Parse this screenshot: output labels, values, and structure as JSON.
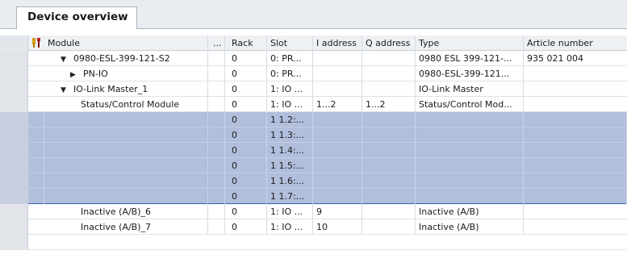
{
  "tab": {
    "label": "Device overview"
  },
  "columns": {
    "module": "Module",
    "dots": "...",
    "rack": "Rack",
    "slot": "Slot",
    "i_address": "I address",
    "q_address": "Q address",
    "type": "Type",
    "article_number": "Article number"
  },
  "rows": [
    {
      "module": "0980-ESL-399-121-S2",
      "rack": "0",
      "slot": "0: PR...",
      "i_address": "",
      "q_address": "",
      "type": "0980 ESL 399-121-...",
      "article_number": "935 021 004",
      "expander": "expanded",
      "level": 1,
      "selected": false
    },
    {
      "module": "PN-IO",
      "rack": "0",
      "slot": "0: PR...",
      "i_address": "",
      "q_address": "",
      "type": "0980-ESL-399-121...",
      "article_number": "",
      "expander": "collapsed",
      "level": 2,
      "selected": false
    },
    {
      "module": "IO-Link Master_1",
      "rack": "0",
      "slot": "1: IO ...",
      "i_address": "",
      "q_address": "",
      "type": "IO-Link Master",
      "article_number": "",
      "expander": "expanded",
      "level": 1,
      "selected": false
    },
    {
      "module": "Status/Control Module",
      "rack": "0",
      "slot": "1: IO ...",
      "i_address": "1...2",
      "q_address": "1...2",
      "type": "Status/Control Mod...",
      "article_number": "",
      "expander": "none",
      "level": 3,
      "selected": false
    },
    {
      "module": "",
      "rack": "0",
      "slot": "1 1.2:...",
      "i_address": "",
      "q_address": "",
      "type": "",
      "article_number": "",
      "expander": "none",
      "level": 3,
      "selected": true
    },
    {
      "module": "",
      "rack": "0",
      "slot": "1 1.3:...",
      "i_address": "",
      "q_address": "",
      "type": "",
      "article_number": "",
      "expander": "none",
      "level": 3,
      "selected": true
    },
    {
      "module": "",
      "rack": "0",
      "slot": "1 1.4:...",
      "i_address": "",
      "q_address": "",
      "type": "",
      "article_number": "",
      "expander": "none",
      "level": 3,
      "selected": true
    },
    {
      "module": "",
      "rack": "0",
      "slot": "1 1.5:...",
      "i_address": "",
      "q_address": "",
      "type": "",
      "article_number": "",
      "expander": "none",
      "level": 3,
      "selected": true
    },
    {
      "module": "",
      "rack": "0",
      "slot": "1 1.6:...",
      "i_address": "",
      "q_address": "",
      "type": "",
      "article_number": "",
      "expander": "none",
      "level": 3,
      "selected": true
    },
    {
      "module": "",
      "rack": "0",
      "slot": "1 1.7:...",
      "i_address": "",
      "q_address": "",
      "type": "",
      "article_number": "",
      "expander": "none",
      "level": 3,
      "selected": true
    },
    {
      "module": "Inactive (A/B)_6",
      "rack": "0",
      "slot": "1: IO ...",
      "i_address": "9",
      "q_address": "",
      "type": "Inactive (A/B)",
      "article_number": "",
      "expander": "none",
      "level": 3,
      "selected": false
    },
    {
      "module": "Inactive (A/B)_7",
      "rack": "0",
      "slot": "1: IO ...",
      "i_address": "10",
      "q_address": "",
      "type": "Inactive (A/B)",
      "article_number": "",
      "expander": "none",
      "level": 3,
      "selected": false
    }
  ],
  "colors": {
    "selection": "#b1bfdc",
    "header": "#eef1f4",
    "tabstrip": "#e9edf1"
  },
  "icons": {
    "header_tool": "tools-icon",
    "expanded": "triangle-down-icon",
    "collapsed": "triangle-right-icon"
  }
}
